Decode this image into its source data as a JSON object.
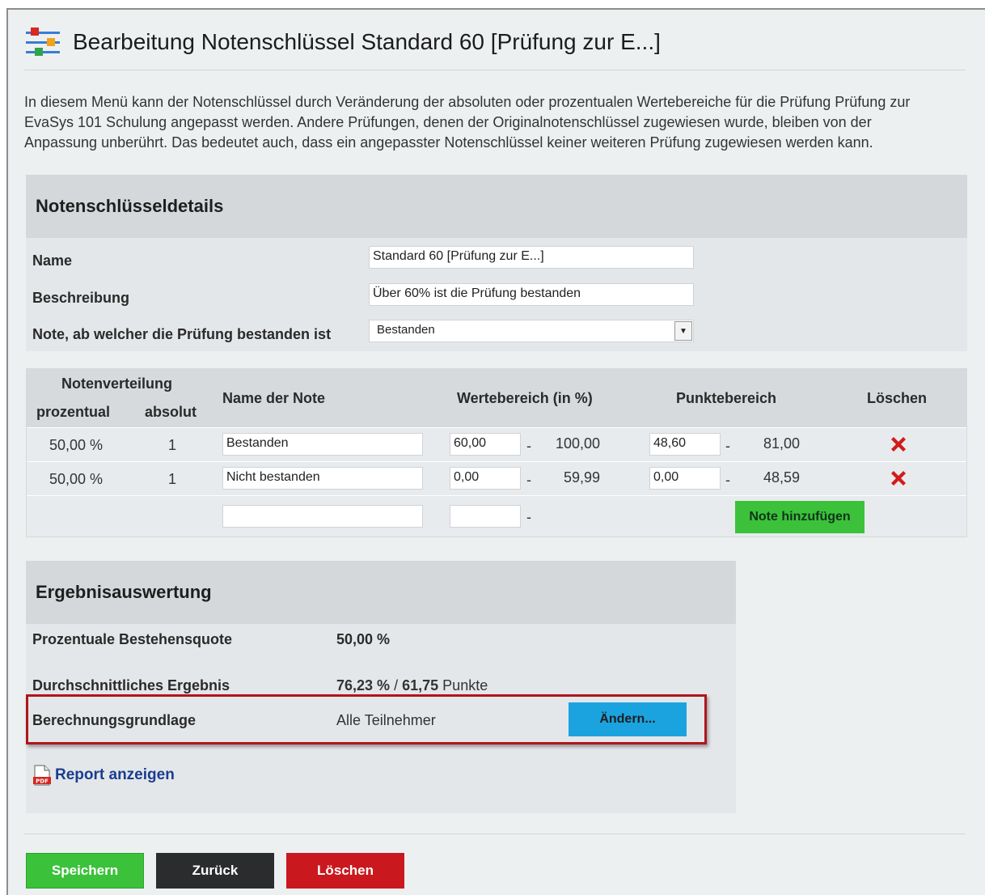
{
  "page": {
    "title": "Bearbeitung Notenschlüssel Standard 60 [Prüfung zur E...]",
    "icon": "settings-sliders-icon",
    "intro_lines": [
      "In diesem Menü kann der Notenschlüssel durch Veränderung der absoluten oder prozentualen Wertebereiche für die Prüfung Prüfung zur",
      "EvaSys 101 Schulung angepasst werden. Andere Prüfungen, denen der Originalnotenschlüssel zugewiesen wurde, bleiben von der",
      "Anpassung unberührt. Das bedeutet auch, dass ein angepasster Notenschlüssel keiner weiteren Prüfung zugewiesen werden kann."
    ]
  },
  "details": {
    "heading": "Notenschlüsseldetails",
    "name_label": "Name",
    "name_value": "Standard 60 [Prüfung zur E...]",
    "description_label": "Beschreibung",
    "description_value": "Über 60% ist die Prüfung bestanden",
    "pass_label": "Note, ab welcher die Prüfung bestanden ist",
    "pass_value": "Bestanden"
  },
  "grades": {
    "headers": {
      "distribution": "Notenverteilung",
      "percent": "prozentual",
      "absolute": "absolut",
      "name": "Name der Note",
      "value_range": "Wertebereich (in %)",
      "points_range": "Punktebereich",
      "delete": "Löschen"
    },
    "separator": "-",
    "rows": [
      {
        "percent": "50,00 %",
        "absolute": "1",
        "name": "Bestanden",
        "range_from": "60,00",
        "range_to": "100,00",
        "points_from": "48,60",
        "points_to": "81,00"
      },
      {
        "percent": "50,00 %",
        "absolute": "1",
        "name": "Nicht bestanden",
        "range_from": "0,00",
        "range_to": "59,99",
        "points_from": "0,00",
        "points_to": "48,59"
      }
    ],
    "add_button": "Note hinzufügen"
  },
  "results": {
    "heading": "Ergebnisauswertung",
    "pass_rate_label": "Prozentuale Bestehensquote",
    "pass_rate_value": "50,00 %",
    "average_label": "Durchschnittliches Ergebnis",
    "average_percent": "76,23 %",
    "average_sep": "/",
    "average_points": "61,75",
    "average_points_unit": "Punkte",
    "basis_label": "Berechnungsgrundlage",
    "basis_value": "Alle Teilnehmer",
    "change_button": "Ändern...",
    "report_link": "Report anzeigen"
  },
  "footer": {
    "save": "Speichern",
    "back": "Zurück",
    "delete": "Löschen"
  },
  "colors": {
    "green": "#3cc13b",
    "dark": "#2b2c2e",
    "red": "#c9181e",
    "blue": "#1ba3e0",
    "delete_icon": "#d21a1a",
    "highlight": "#b0151c"
  }
}
